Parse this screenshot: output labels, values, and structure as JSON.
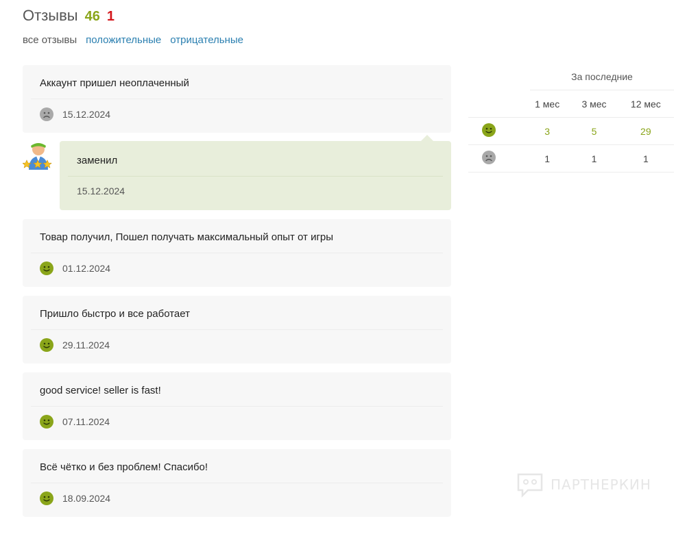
{
  "header": {
    "title": "Отзывы",
    "positive_count": "46",
    "negative_count": "1"
  },
  "filters": {
    "all": "все отзывы",
    "positive": "положительные",
    "negative": "отрицательные"
  },
  "reviews": [
    {
      "type": "negative",
      "text": "Аккаунт пришел неоплаченный",
      "date": "15.12.2024",
      "reply": {
        "text": "заменил",
        "date": "15.12.2024"
      }
    },
    {
      "type": "positive",
      "text": "Товар получил, Пошел получать максимальный опыт от игры",
      "date": "01.12.2024"
    },
    {
      "type": "positive",
      "text": "Пришло быстро и все работает",
      "date": "29.11.2024"
    },
    {
      "type": "positive",
      "text": "good service! seller is fast!",
      "date": "07.11.2024"
    },
    {
      "type": "positive",
      "text": "Всё чётко и без проблем! Спасибо!",
      "date": "18.09.2024"
    }
  ],
  "stats": {
    "period_label": "За последние",
    "columns": [
      "1 мес",
      "3 мес",
      "12 мес"
    ],
    "positive": [
      "3",
      "5",
      "29"
    ],
    "negative": [
      "1",
      "1",
      "1"
    ]
  },
  "watermark": {
    "text": "ПАРТНЕРКИН"
  },
  "colors": {
    "positive": "#8aa51a",
    "negative": "#d4161b",
    "link": "#2a7fb0",
    "reply_bg": "#e8eedb"
  }
}
